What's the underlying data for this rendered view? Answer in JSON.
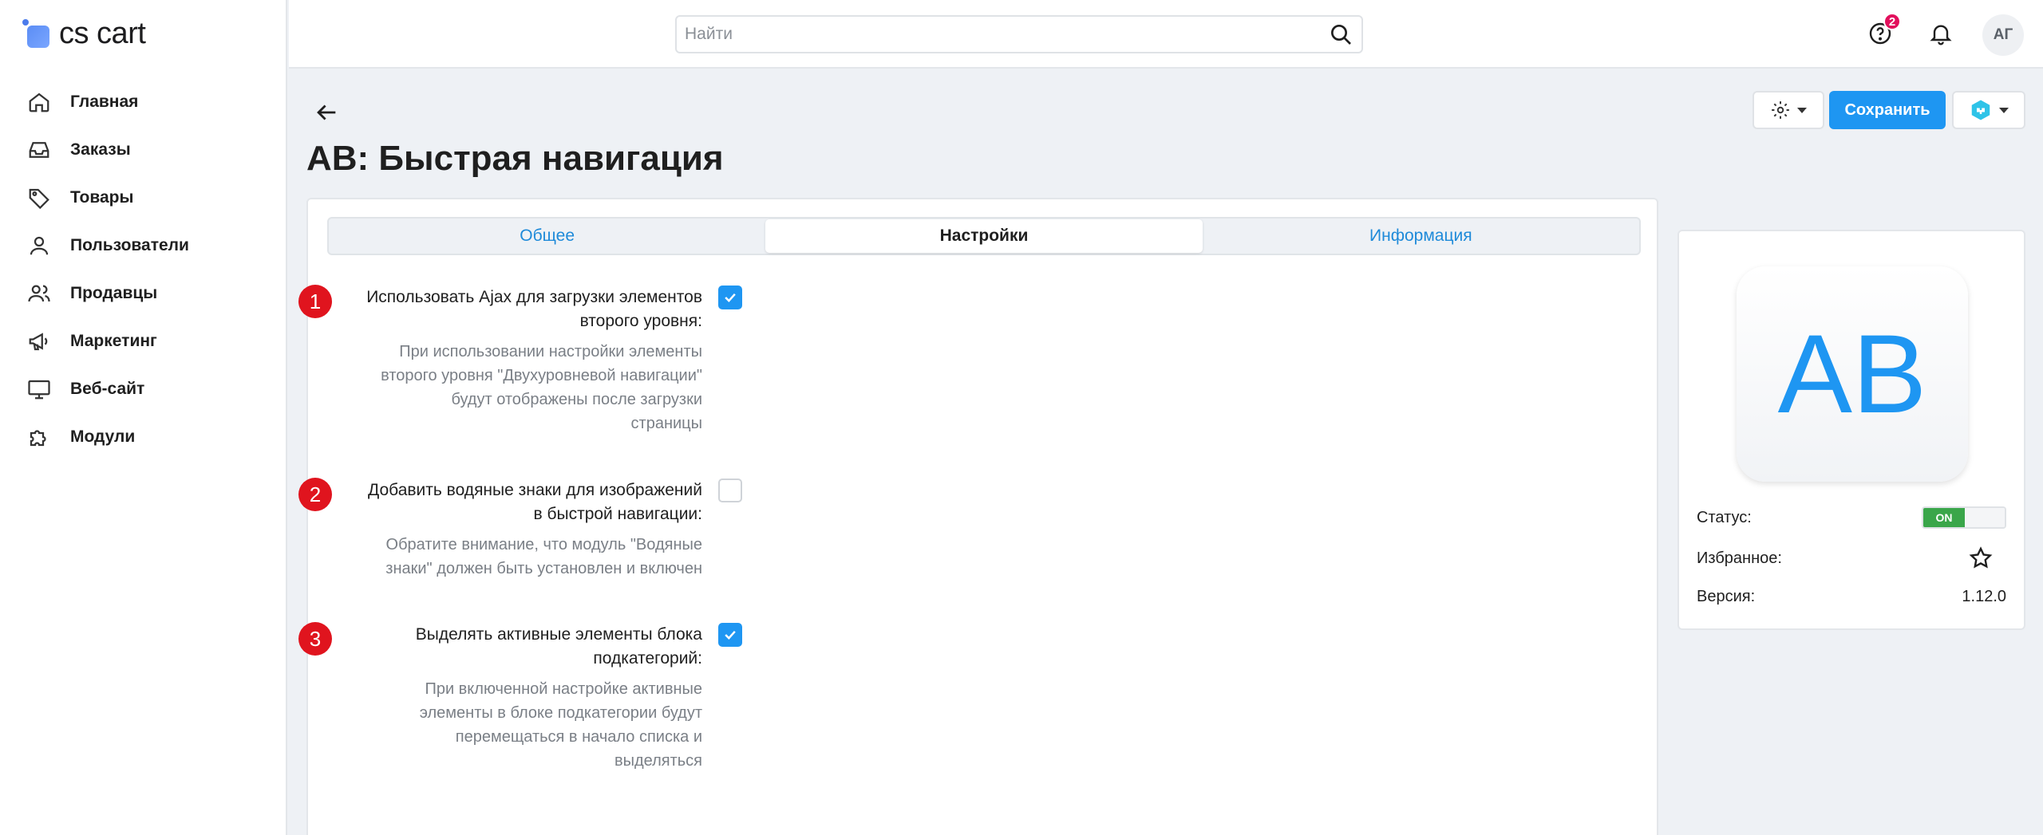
{
  "brand": {
    "name": "cs cart"
  },
  "sidebar": {
    "items": [
      {
        "label": "Главная",
        "icon": "home-icon"
      },
      {
        "label": "Заказы",
        "icon": "inbox-icon"
      },
      {
        "label": "Товары",
        "icon": "tag-icon"
      },
      {
        "label": "Пользователи",
        "icon": "user-icon"
      },
      {
        "label": "Продавцы",
        "icon": "users-icon"
      },
      {
        "label": "Маркетинг",
        "icon": "megaphone-icon"
      },
      {
        "label": "Веб-сайт",
        "icon": "monitor-icon"
      },
      {
        "label": "Модули",
        "icon": "puzzle-icon"
      }
    ]
  },
  "topbar": {
    "search_placeholder": "Найти",
    "help_badge": "2",
    "avatar_initials": "АГ"
  },
  "header": {
    "title": "AB: Быстрая навигация",
    "save_label": "Сохранить"
  },
  "tabs": [
    {
      "label": "Общее",
      "active": false
    },
    {
      "label": "Настройки",
      "active": true
    },
    {
      "label": "Информация",
      "active": false
    }
  ],
  "settings": [
    {
      "number": "1",
      "label_lines": [
        "Использовать Ajax для загрузки элементов",
        "второго уровня:"
      ],
      "hint_lines": [
        "При использовании настройки элементы",
        "второго уровня \"Двухуровневой навигации\"",
        "будут отображены после загрузки",
        "страницы"
      ],
      "checked": true
    },
    {
      "number": "2",
      "label_lines": [
        "Добавить водяные знаки для изображений",
        "в быстрой навигации:"
      ],
      "hint_lines": [
        "Обратите внимание, что модуль \"Водяные",
        "знаки\" должен быть установлен и включен"
      ],
      "checked": false
    },
    {
      "number": "3",
      "label_lines": [
        "Выделять активные элементы блока",
        "подкатегорий:"
      ],
      "hint_lines": [
        "При включенной настройке активные",
        "элементы в блоке подкатегории будут",
        "перемещаться в начало списка и",
        "выделяться"
      ],
      "checked": true
    }
  ],
  "addon_card": {
    "logo_text": "AB",
    "status_label": "Статус:",
    "status_value": "ON",
    "favorite_label": "Избранное:",
    "version_label": "Версия:",
    "version_value": "1.12.0"
  },
  "colors": {
    "accent": "#1e96f2",
    "badge": "#e2105c",
    "marker": "#e0141e",
    "status_on": "#3aa64a"
  }
}
